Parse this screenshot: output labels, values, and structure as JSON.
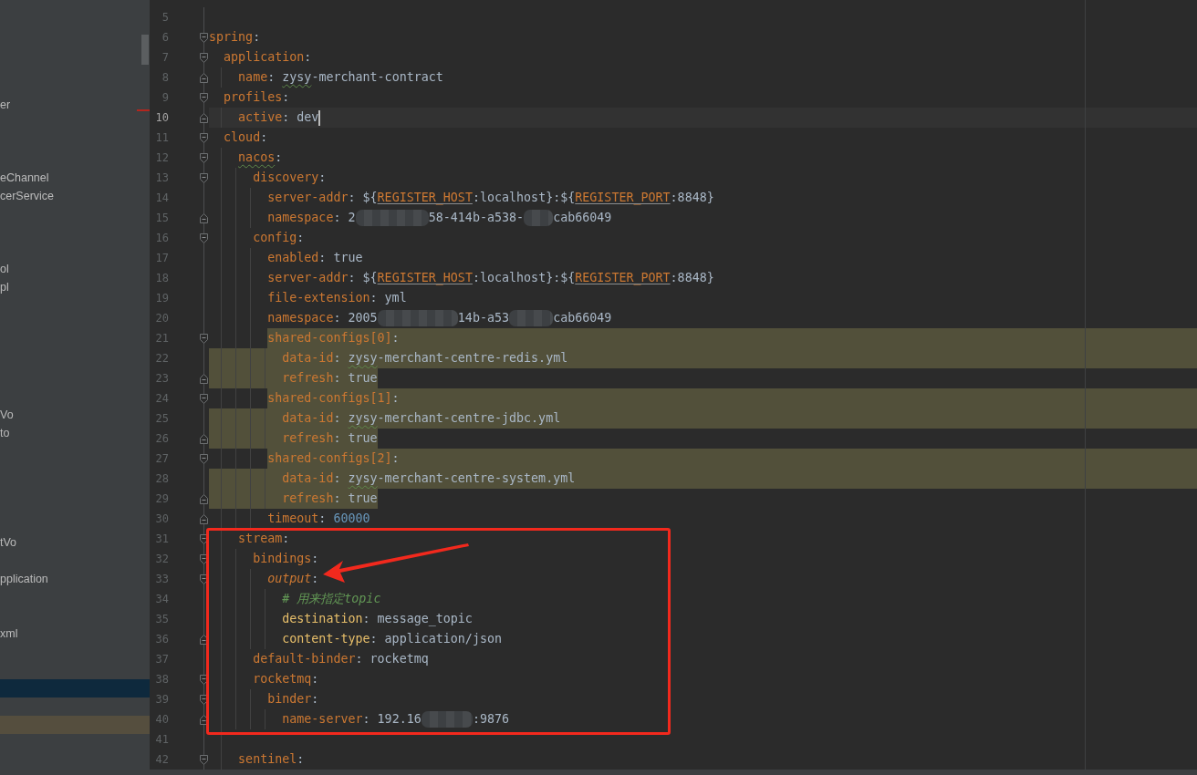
{
  "sidebar": {
    "error_mark": true,
    "rows": [
      {
        "selected": false,
        "highlighted": false
      },
      {
        "selected": false,
        "highlighted": false
      },
      {
        "selected": false,
        "highlighted": false
      },
      {
        "selected": false,
        "highlighted": false
      },
      {
        "selected": false,
        "highlighted": false
      },
      {
        "label": "er",
        "selected": false,
        "highlighted": false
      },
      {
        "selected": false,
        "highlighted": false
      },
      {
        "selected": false,
        "highlighted": false
      },
      {
        "selected": false,
        "highlighted": false
      },
      {
        "label": "eChannel",
        "selected": false,
        "highlighted": false
      },
      {
        "label": "cerService",
        "selected": false,
        "highlighted": false
      },
      {
        "selected": false,
        "highlighted": false
      },
      {
        "selected": false,
        "highlighted": false
      },
      {
        "selected": false,
        "highlighted": false
      },
      {
        "label": "ol",
        "selected": false,
        "highlighted": false
      },
      {
        "label": "pl",
        "selected": false,
        "highlighted": false
      },
      {
        "selected": false,
        "highlighted": false
      },
      {
        "selected": false,
        "highlighted": false
      },
      {
        "selected": false,
        "highlighted": false
      },
      {
        "selected": false,
        "highlighted": false
      },
      {
        "selected": false,
        "highlighted": false
      },
      {
        "selected": false,
        "highlighted": false
      },
      {
        "label": "Vo",
        "selected": false,
        "highlighted": false
      },
      {
        "label": "to",
        "selected": false,
        "highlighted": false
      },
      {
        "selected": false,
        "highlighted": false
      },
      {
        "selected": false,
        "highlighted": false
      },
      {
        "selected": false,
        "highlighted": false
      },
      {
        "selected": false,
        "highlighted": false
      },
      {
        "selected": false,
        "highlighted": false
      },
      {
        "label": "tVo",
        "selected": false,
        "highlighted": false
      },
      {
        "selected": false,
        "highlighted": false
      },
      {
        "label": "pplication",
        "selected": false,
        "highlighted": false
      },
      {
        "selected": false,
        "highlighted": false
      },
      {
        "selected": false,
        "highlighted": false
      },
      {
        "label": "xml",
        "selected": false,
        "highlighted": false
      },
      {
        "selected": false,
        "highlighted": false
      },
      {
        "selected": false,
        "highlighted": false
      },
      {
        "selected": true,
        "highlighted": false
      },
      {
        "selected": false,
        "highlighted": false
      },
      {
        "selected": false,
        "highlighted": true
      },
      {
        "selected": false,
        "highlighted": false
      },
      {
        "selected": false,
        "highlighted": false
      }
    ]
  },
  "editor": {
    "lines": [
      {
        "number": "5",
        "current": false,
        "highlighted": false
      },
      {
        "number": "6",
        "current": false,
        "highlighted": false,
        "expanded": true,
        "tokens": [
          {
            "kind": "key",
            "text": "spring"
          },
          {
            "kind": "punct",
            "text": ":"
          }
        ],
        "children": [
          {
            "number": "7",
            "current": false,
            "highlighted": false,
            "expanded": true,
            "tokens": [
              {
                "kind": "key",
                "text": "application"
              },
              {
                "kind": "punct",
                "text": ":"
              }
            ],
            "children": [
              {
                "number": "8",
                "current": false,
                "highlighted": false,
                "tokens": [
                  {
                    "kind": "key",
                    "text": "name"
                  },
                  {
                    "kind": "punct",
                    "text": ": "
                  },
                  {
                    "kind": "value-typo",
                    "text": "zysy"
                  },
                  {
                    "kind": "value",
                    "text": "-merchant-contract"
                  }
                ]
              }
            ]
          },
          {
            "number": "9",
            "current": false,
            "highlighted": false,
            "expanded": true,
            "tokens": [
              {
                "kind": "key",
                "text": "profiles"
              },
              {
                "kind": "punct",
                "text": ":"
              }
            ],
            "children": [
              {
                "number": "10",
                "current": true,
                "highlighted": false,
                "tokens": [
                  {
                    "kind": "key",
                    "text": "active"
                  },
                  {
                    "kind": "punct",
                    "text": ": "
                  },
                  {
                    "kind": "value",
                    "text": "dev"
                  }
                ]
              }
            ]
          },
          {
            "number": "11",
            "current": false,
            "highlighted": false,
            "expanded": true,
            "tokens": [
              {
                "kind": "key",
                "text": "cloud"
              },
              {
                "kind": "punct",
                "text": ":"
              }
            ],
            "children": [
              {
                "number": "12",
                "current": false,
                "highlighted": false,
                "expanded": true,
                "tokens": [
                  {
                    "kind": "key-typo",
                    "text": "nacos"
                  },
                  {
                    "kind": "punct",
                    "text": ":"
                  }
                ],
                "children": [
                  {
                    "number": "13",
                    "current": false,
                    "highlighted": false,
                    "expanded": true,
                    "tokens": [
                      {
                        "kind": "key",
                        "text": "discovery"
                      },
                      {
                        "kind": "punct",
                        "text": ":"
                      }
                    ],
                    "children": [
                      {
                        "number": "14",
                        "current": false,
                        "highlighted": false,
                        "tokens": [
                          {
                            "kind": "key",
                            "text": "server-addr"
                          },
                          {
                            "kind": "punct",
                            "text": ": "
                          },
                          {
                            "kind": "value",
                            "text": "${"
                          },
                          {
                            "kind": "env",
                            "text": "REGISTER_HOST"
                          },
                          {
                            "kind": "value",
                            "text": ":localhost}:${"
                          },
                          {
                            "kind": "env",
                            "text": "REGISTER_PORT"
                          },
                          {
                            "kind": "value",
                            "text": ":8848}"
                          }
                        ]
                      },
                      {
                        "number": "15",
                        "current": false,
                        "highlighted": false,
                        "tokens": [
                          {
                            "kind": "key",
                            "text": "namespace"
                          },
                          {
                            "kind": "punct",
                            "text": ": "
                          },
                          {
                            "kind": "value",
                            "text": "2"
                          },
                          {
                            "kind": "redacted"
                          },
                          {
                            "kind": "value",
                            "text": "58-414b-a538-"
                          },
                          {
                            "kind": "redacted"
                          },
                          {
                            "kind": "value",
                            "text": "cab66049"
                          }
                        ]
                      }
                    ]
                  },
                  {
                    "number": "16",
                    "current": false,
                    "highlighted": false,
                    "expanded": true,
                    "tokens": [
                      {
                        "kind": "key",
                        "text": "config"
                      },
                      {
                        "kind": "punct",
                        "text": ":"
                      }
                    ],
                    "children": [
                      {
                        "number": "17",
                        "current": false,
                        "highlighted": false,
                        "tokens": [
                          {
                            "kind": "key",
                            "text": "enabled"
                          },
                          {
                            "kind": "punct",
                            "text": ": "
                          },
                          {
                            "kind": "value",
                            "text": "true"
                          }
                        ]
                      },
                      {
                        "number": "18",
                        "current": false,
                        "highlighted": false,
                        "tokens": [
                          {
                            "kind": "key",
                            "text": "server-addr"
                          },
                          {
                            "kind": "punct",
                            "text": ": "
                          },
                          {
                            "kind": "value",
                            "text": "${"
                          },
                          {
                            "kind": "env",
                            "text": "REGISTER_HOST"
                          },
                          {
                            "kind": "value",
                            "text": ":localhost}:${"
                          },
                          {
                            "kind": "env",
                            "text": "REGISTER_PORT"
                          },
                          {
                            "kind": "value",
                            "text": ":8848}"
                          }
                        ]
                      },
                      {
                        "number": "19",
                        "current": false,
                        "highlighted": false,
                        "tokens": [
                          {
                            "kind": "key",
                            "text": "file-extension"
                          },
                          {
                            "kind": "punct",
                            "text": ": "
                          },
                          {
                            "kind": "value",
                            "text": "yml"
                          }
                        ]
                      },
                      {
                        "number": "20",
                        "current": false,
                        "highlighted": false,
                        "tokens": [
                          {
                            "kind": "key",
                            "text": "namespace"
                          },
                          {
                            "kind": "punct",
                            "text": ": "
                          },
                          {
                            "kind": "value",
                            "text": "2005"
                          },
                          {
                            "kind": "redacted"
                          },
                          {
                            "kind": "value",
                            "text": "14b-a53"
                          },
                          {
                            "kind": "redacted"
                          },
                          {
                            "kind": "value",
                            "text": "cab66049"
                          }
                        ]
                      },
                      {
                        "number": "21",
                        "current": false,
                        "highlighted": true,
                        "expanded": true,
                        "tokens": [
                          {
                            "kind": "key",
                            "text": "shared-configs[0]"
                          },
                          {
                            "kind": "punct",
                            "text": ":"
                          }
                        ],
                        "children": [
                          {
                            "number": "22",
                            "current": false,
                            "highlighted": true,
                            "tokens": [
                              {
                                "kind": "key",
                                "text": "data-id"
                              },
                              {
                                "kind": "punct",
                                "text": ": "
                              },
                              {
                                "kind": "value-typo",
                                "text": "zysy"
                              },
                              {
                                "kind": "value",
                                "text": "-merchant-centre-redis.yml"
                              }
                            ]
                          },
                          {
                            "number": "23",
                            "current": false,
                            "highlighted": true,
                            "tokens": [
                              {
                                "kind": "key",
                                "text": "refresh"
                              },
                              {
                                "kind": "punct",
                                "text": ": "
                              },
                              {
                                "kind": "value",
                                "text": "true"
                              }
                            ]
                          }
                        ]
                      },
                      {
                        "number": "24",
                        "current": false,
                        "highlighted": true,
                        "expanded": true,
                        "tokens": [
                          {
                            "kind": "key",
                            "text": "shared-configs[1]"
                          },
                          {
                            "kind": "punct",
                            "text": ":"
                          }
                        ],
                        "children": [
                          {
                            "number": "25",
                            "current": false,
                            "highlighted": true,
                            "tokens": [
                              {
                                "kind": "key",
                                "text": "data-id"
                              },
                              {
                                "kind": "punct",
                                "text": ": "
                              },
                              {
                                "kind": "value-typo",
                                "text": "zysy"
                              },
                              {
                                "kind": "value",
                                "text": "-merchant-centre-jdbc.yml"
                              }
                            ]
                          },
                          {
                            "number": "26",
                            "current": false,
                            "highlighted": true,
                            "tokens": [
                              {
                                "kind": "key",
                                "text": "refresh"
                              },
                              {
                                "kind": "punct",
                                "text": ": "
                              },
                              {
                                "kind": "value",
                                "text": "true"
                              }
                            ]
                          }
                        ]
                      },
                      {
                        "number": "27",
                        "current": false,
                        "highlighted": true,
                        "expanded": true,
                        "tokens": [
                          {
                            "kind": "key",
                            "text": "shared-configs[2]"
                          },
                          {
                            "kind": "punct",
                            "text": ":"
                          }
                        ],
                        "children": [
                          {
                            "number": "28",
                            "current": false,
                            "highlighted": true,
                            "tokens": [
                              {
                                "kind": "key",
                                "text": "data-id"
                              },
                              {
                                "kind": "punct",
                                "text": ": "
                              },
                              {
                                "kind": "value-typo",
                                "text": "zysy"
                              },
                              {
                                "kind": "value",
                                "text": "-merchant-centre-system.yml"
                              }
                            ]
                          },
                          {
                            "number": "29",
                            "current": false,
                            "highlighted": true,
                            "tokens": [
                              {
                                "kind": "key",
                                "text": "refresh"
                              },
                              {
                                "kind": "punct",
                                "text": ": "
                              },
                              {
                                "kind": "value",
                                "text": "true"
                              }
                            ]
                          }
                        ]
                      },
                      {
                        "number": "30",
                        "current": false,
                        "highlighted": false,
                        "tokens": [
                          {
                            "kind": "key",
                            "text": "timeout"
                          },
                          {
                            "kind": "punct",
                            "text": ": "
                          },
                          {
                            "kind": "number",
                            "text": "60000"
                          }
                        ]
                      }
                    ]
                  }
                ]
              },
              {
                "number": "31",
                "current": false,
                "highlighted": false,
                "expanded": true,
                "tokens": [
                  {
                    "kind": "key",
                    "text": "stream"
                  },
                  {
                    "kind": "punct",
                    "text": ":"
                  }
                ],
                "children": [
                  {
                    "number": "32",
                    "current": false,
                    "highlighted": false,
                    "expanded": true,
                    "tokens": [
                      {
                        "kind": "key",
                        "text": "bindings"
                      },
                      {
                        "kind": "punct",
                        "text": ":"
                      }
                    ],
                    "children": [
                      {
                        "number": "33",
                        "current": false,
                        "highlighted": false,
                        "expanded": true,
                        "tokens": [
                          {
                            "kind": "key-italic",
                            "text": "output"
                          },
                          {
                            "kind": "punct",
                            "text": ":"
                          }
                        ],
                        "children": [
                          {
                            "number": "34",
                            "current": false,
                            "highlighted": false,
                            "tokens": [
                              {
                                "kind": "comment",
                                "text": "# 用来指定topic"
                              }
                            ]
                          },
                          {
                            "number": "35",
                            "current": false,
                            "highlighted": false,
                            "tokens": [
                              {
                                "kind": "key-bright",
                                "text": "destination"
                              },
                              {
                                "kind": "punct",
                                "text": ": "
                              },
                              {
                                "kind": "value",
                                "text": "message_topic"
                              }
                            ]
                          },
                          {
                            "number": "36",
                            "current": false,
                            "highlighted": false,
                            "tokens": [
                              {
                                "kind": "key-bright",
                                "text": "content-type"
                              },
                              {
                                "kind": "punct",
                                "text": ": "
                              },
                              {
                                "kind": "value",
                                "text": "application/json"
                              }
                            ]
                          }
                        ]
                      }
                    ]
                  },
                  {
                    "number": "37",
                    "current": false,
                    "highlighted": false,
                    "tokens": [
                      {
                        "kind": "key",
                        "text": "default-binder"
                      },
                      {
                        "kind": "punct",
                        "text": ": "
                      },
                      {
                        "kind": "value",
                        "text": "rocketmq"
                      }
                    ]
                  },
                  {
                    "number": "38",
                    "current": false,
                    "highlighted": false,
                    "expanded": true,
                    "tokens": [
                      {
                        "kind": "key",
                        "text": "rocketmq"
                      },
                      {
                        "kind": "punct",
                        "text": ":"
                      }
                    ],
                    "children": [
                      {
                        "number": "39",
                        "current": false,
                        "highlighted": false,
                        "expanded": true,
                        "tokens": [
                          {
                            "kind": "key",
                            "text": "binder"
                          },
                          {
                            "kind": "punct",
                            "text": ":"
                          }
                        ],
                        "children": [
                          {
                            "number": "40",
                            "current": false,
                            "highlighted": false,
                            "tokens": [
                              {
                                "kind": "key",
                                "text": "name-server"
                              },
                              {
                                "kind": "punct",
                                "text": ": "
                              },
                              {
                                "kind": "value",
                                "text": "192.16"
                              },
                              {
                                "kind": "redacted"
                              },
                              {
                                "kind": "value",
                                "text": ":9876"
                              }
                            ]
                          }
                        ]
                      }
                    ]
                  }
                ]
              },
              {
                "number": "41",
                "current": false,
                "highlighted": false
              },
              {
                "number": "42",
                "current": false,
                "highlighted": false,
                "expanded": true,
                "tokens": [
                  {
                    "kind": "key",
                    "text": "sentinel"
                  },
                  {
                    "kind": "punct",
                    "text": ":"
                  }
                ]
              }
            ]
          }
        ]
      }
    ]
  },
  "annotations": [
    {
      "kind": "frame"
    },
    {
      "kind": "arrow"
    }
  ]
}
